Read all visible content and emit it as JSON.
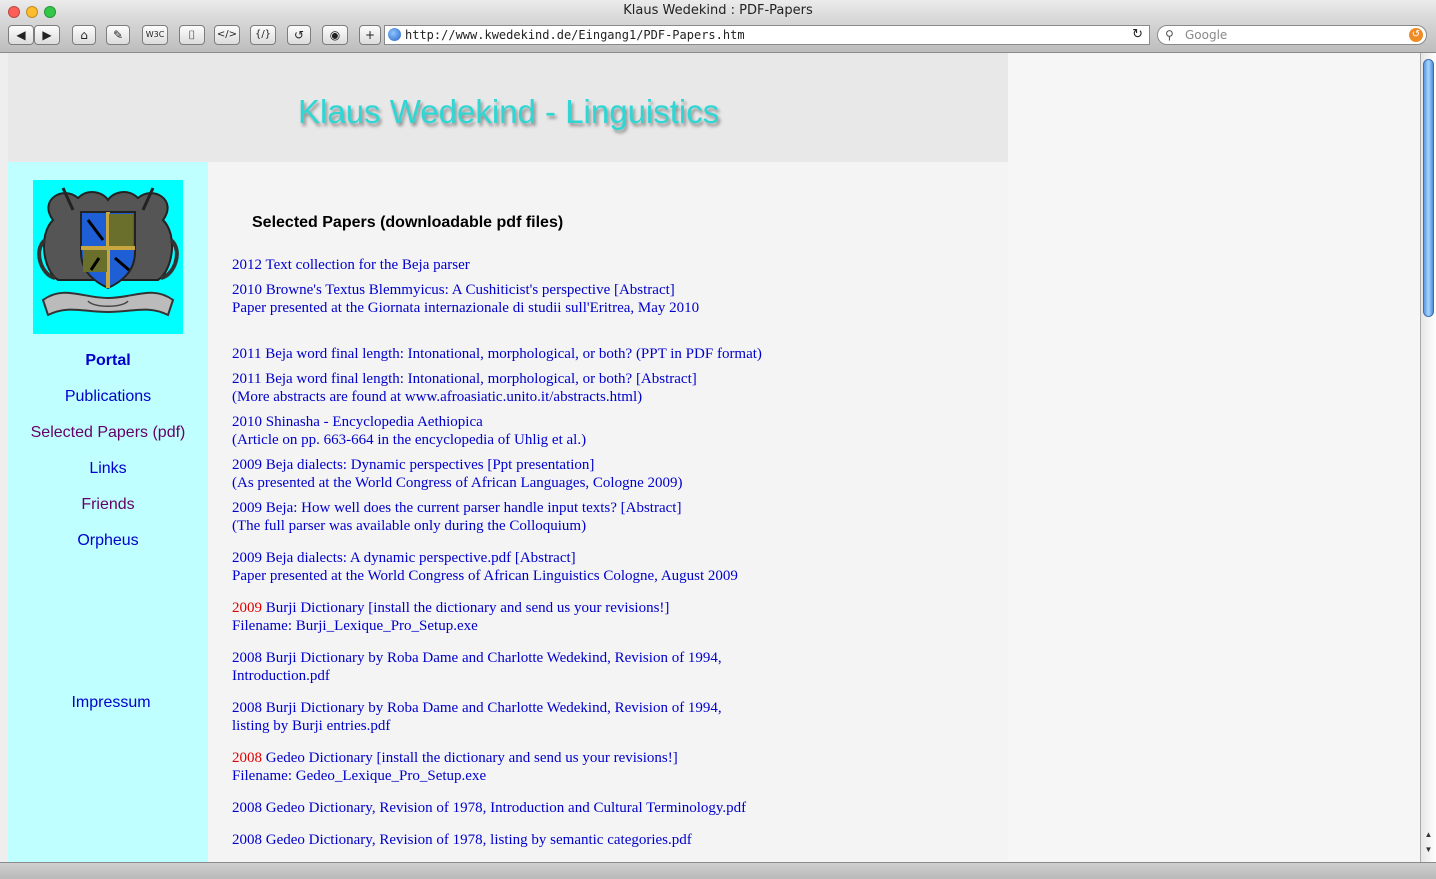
{
  "window": {
    "title": "Klaus Wedekind : PDF-Papers"
  },
  "toolbar": {
    "back": "◀",
    "forward": "▶",
    "home": "⌂",
    "edit": "✎",
    "w3c": "W3C",
    "archive": "⌷",
    "source": "</>",
    "source2": "{/}",
    "refresh": "↺",
    "stop": "◉",
    "add": "+",
    "url": "http://www.kwedekind.de/Eingang1/PDF-Papers.htm",
    "reload": "↻",
    "search_placeholder": "Google"
  },
  "site": {
    "title": "Klaus Wedekind - Linguistics"
  },
  "nav": [
    {
      "label": "Portal",
      "color": "#0000cc",
      "bold": true
    },
    {
      "label": "Publications",
      "color": "#0000cc",
      "bold": false
    },
    {
      "label": "Selected Papers (pdf)",
      "color": "#660066",
      "bold": false
    },
    {
      "label": "Links",
      "color": "#0000cc",
      "bold": false
    },
    {
      "label": "Friends",
      "color": "#660066",
      "bold": false
    },
    {
      "label": "Orpheus",
      "color": "#0000cc",
      "bold": false
    }
  ],
  "impressum": "Impressum",
  "heading": "Selected Papers (downloadable pdf files)",
  "entries": [
    {
      "year": "",
      "lines": [
        "2012 Text collection for the Beja parser"
      ]
    },
    {
      "year": "",
      "lines": [
        "2010 Browne's Textus Blemmyicus: A Cushiticist's perspective [Abstract]",
        "Paper presented at the Giornata internazionale di studii sull'Eritrea, May 2010"
      ]
    },
    {
      "year": "",
      "lines": [
        "2011 Beja word final length: Intonational, morphological, or both? (PPT in PDF format)"
      ]
    },
    {
      "year": "",
      "lines": [
        "2011 Beja word final length: Intonational, morphological, or both? [Abstract]",
        "(More abstracts are found at www.afroasiatic.unito.it/abstracts.html)"
      ]
    },
    {
      "year": "",
      "lines": [
        "2010 Shinasha - Encyclopedia Aethiopica",
        "(Article on pp. 663-664 in the encyclopedia of Uhlig et al.)"
      ]
    },
    {
      "year": "",
      "lines": [
        "2009 Beja dialects: Dynamic perspectives [Ppt presentation]",
        "(As presented at the World Congress of African Languages, Cologne 2009)"
      ]
    },
    {
      "year": "",
      "lines": [
        "2009 Beja: How well does the current parser handle input texts? [Abstract]",
        "(The full parser was available only during the Colloquium)"
      ]
    },
    {
      "year": "",
      "lines": [
        "2009 Beja dialects: A dynamic perspective.pdf [Abstract]",
        "Paper presented at the World Congress of African Linguistics Cologne, August 2009"
      ]
    },
    {
      "year": "2009",
      "lines": [
        " Burji Dictionary [install the dictionary and send us your revisions!]",
        "Filename: Burji_Lexique_Pro_Setup.exe"
      ]
    },
    {
      "year": "",
      "lines": [
        "2008 Burji Dictionary by Roba Dame and Charlotte Wedekind, Revision of 1994,",
        "Introduction.pdf"
      ]
    },
    {
      "year": "",
      "lines": [
        "2008 Burji Dictionary by Roba Dame and Charlotte Wedekind, Revision of 1994,",
        "listing by Burji entries.pdf"
      ]
    },
    {
      "year": "2008",
      "lines": [
        " Gedeo Dictionary [install the dictionary and send us your revisions!]",
        "Filename: Gedeo_Lexique_Pro_Setup.exe"
      ]
    },
    {
      "year": "",
      "lines": [
        "2008 Gedeo Dictionary, Revision of 1978, Introduction and Cultural Terminology.pdf"
      ]
    },
    {
      "year": "",
      "lines": [
        "2008 Gedeo Dictionary, Revision of 1978, listing by semantic categories.pdf"
      ]
    }
  ],
  "colors": {
    "sidebar": "#bfffff",
    "header": "#e8e8e8",
    "link": "#0000cc",
    "visited": "#660066",
    "year_highlight": "#e00000",
    "title": "#2fd7d4"
  }
}
